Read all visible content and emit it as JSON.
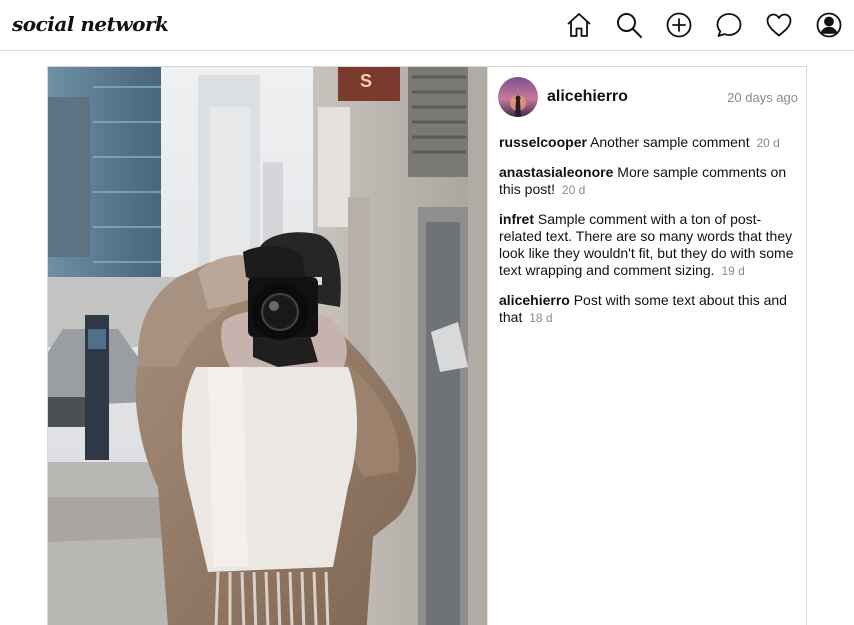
{
  "app": {
    "title": "social network"
  },
  "nav": {
    "icons": [
      "home-icon",
      "search-icon",
      "add-icon",
      "messages-icon",
      "likes-icon",
      "profile-icon"
    ]
  },
  "post": {
    "author": "alicehierro",
    "age": "20 days ago",
    "image": "photo of a person in a tan puffer jacket and white fringed scarf photographing with a camera on a city street"
  },
  "comments": [
    {
      "user": "russelcooper",
      "text": "Another sample comment",
      "time": "20 d"
    },
    {
      "user": "anastasialeonore",
      "text": "More sample comments on this post!",
      "time": "20 d"
    },
    {
      "user": "infret",
      "text": "Sample comment with a ton of post-related text. There are so many words that they look like they wouldn't fit, but they do with some text wrapping and comment sizing.",
      "time": "19 d"
    },
    {
      "user": "alicehierro",
      "text": "Post with some text about this and that",
      "time": "18 d"
    }
  ]
}
